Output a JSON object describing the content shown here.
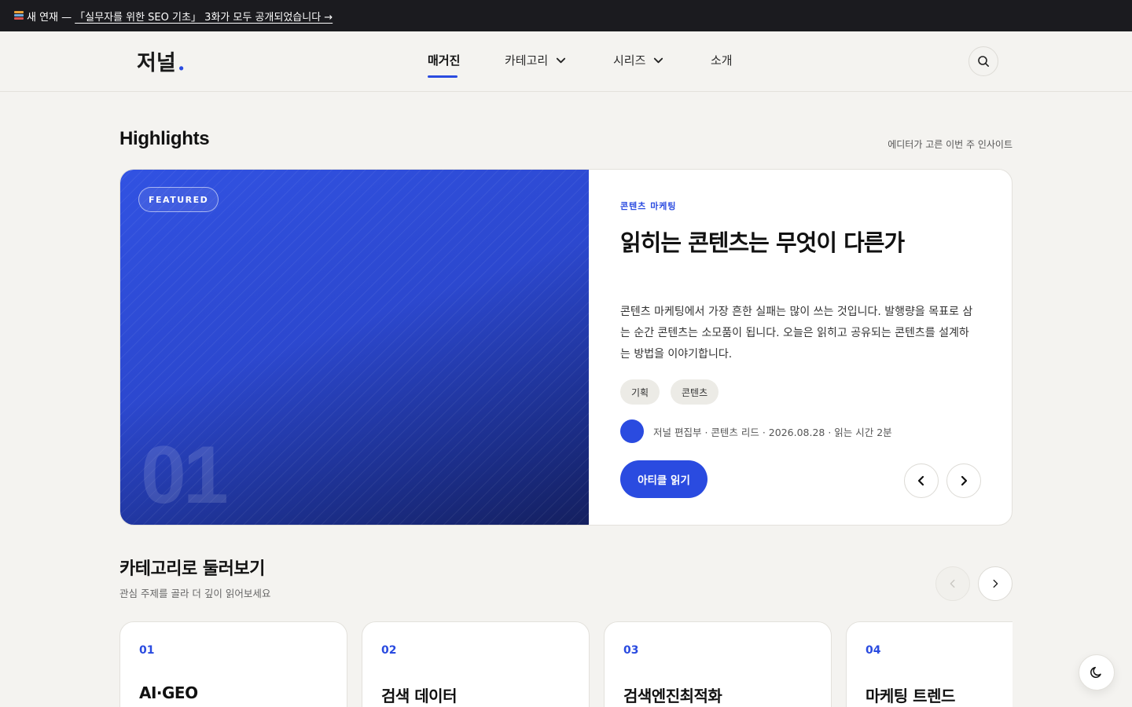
{
  "announcement": {
    "prefix": "새 연재 —",
    "link": "「실무자를 위한 SEO 기초」 3화가 모두 공개되었습니다 →"
  },
  "header": {
    "logo": "저널",
    "logo_dot": ".",
    "nav": [
      "매거진",
      "카테고리",
      "시리즈",
      "소개"
    ],
    "active_nav": "매거진"
  },
  "highlights": {
    "title": "Highlights",
    "subtitle": "에디터가 고른 이번 주 인사이트",
    "featured": {
      "badge": "FEATURED",
      "number": "01",
      "category": "콘텐츠 마케팅",
      "title": "읽히는 콘텐츠는 무엇이 다른가",
      "description": "콘텐츠 마케팅에서 가장 흔한 실패는 많이 쓰는 것입니다. 발행량을 목표로 삼는 순간 콘텐츠는 소모품이 됩니다. 오늘은 읽히고 공유되는 콘텐츠를 설계하는 방법을 이야기합니다.",
      "tags": [
        "기획",
        "콘텐츠"
      ],
      "meta": "저널 편집부 · 콘텐츠 리드 · 2026.08.28 · 읽는 시간 2분",
      "cta": "아티클 읽기"
    }
  },
  "categories": {
    "title": "카테고리로 둘러보기",
    "subtitle": "관심 주제를 골라 더 깊이 읽어보세요",
    "items": [
      {
        "num": "01",
        "name": "AI·GEO"
      },
      {
        "num": "02",
        "name": "검색 데이터"
      },
      {
        "num": "03",
        "name": "검색엔진최적화"
      },
      {
        "num": "04",
        "name": "마케팅 트렌드"
      }
    ]
  },
  "colors": {
    "accent": "#2a4be0",
    "announcement_bg": "#1b1b1f",
    "page_bg": "#f4f3f0"
  },
  "icons": {
    "announcement": "books-icon",
    "search": "search-icon",
    "dropdown": "chevron-down-icon",
    "prev": "chevron-left-icon",
    "next": "chevron-right-icon",
    "theme": "moon-icon"
  }
}
